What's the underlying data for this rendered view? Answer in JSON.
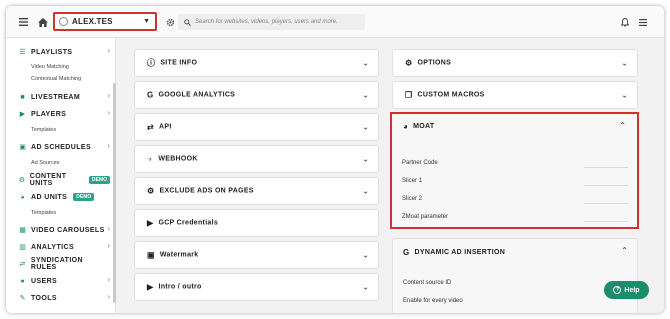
{
  "topbar": {
    "account_name": "ALEX.TES",
    "search_placeholder": "Search for websites, videos, players, users and more."
  },
  "sidebar": {
    "items": [
      {
        "label": "PLAYLISTS",
        "icon": "list-icon"
      },
      {
        "label": "LIVESTREAM",
        "icon": "camera-icon"
      },
      {
        "label": "PLAYERS",
        "icon": "play-circle-icon"
      },
      {
        "label": "AD SCHEDULES",
        "icon": "ad-icon"
      },
      {
        "label": "CONTENT UNITS",
        "icon": "cogs-icon",
        "badge": "DEMO"
      },
      {
        "label": "AD UNITS",
        "icon": "pie-icon",
        "badge": "DEMO"
      },
      {
        "label": "VIDEO CAROUSELS",
        "icon": "carousel-icon"
      },
      {
        "label": "ANALYTICS",
        "icon": "chart-icon"
      },
      {
        "label": "SYNDICATION RULES",
        "icon": "arrows-icon"
      },
      {
        "label": "USERS",
        "icon": "user-icon"
      },
      {
        "label": "TOOLS",
        "icon": "wrench-icon"
      }
    ],
    "subitems": {
      "playlists_1": "Video Matching",
      "playlists_2": "Contextual Matching",
      "players_1": "Templates",
      "ad_schedules_1": "Ad Sources",
      "ad_units_1": "Templates"
    }
  },
  "left_cards": [
    {
      "title": "SITE INFO",
      "icon": "info-icon"
    },
    {
      "title": "GOOGLE ANALYTICS",
      "icon": "google-icon"
    },
    {
      "title": "API",
      "icon": "swap-icon"
    },
    {
      "title": "WEBHOOK",
      "icon": "webhook-icon"
    },
    {
      "title": "EXCLUDE ADS ON PAGES",
      "icon": "cogs-icon"
    },
    {
      "title": "GCP Credentials",
      "icon": "youtube-icon"
    },
    {
      "title": "Watermark",
      "icon": "image-icon"
    },
    {
      "title": "Intro / outro",
      "icon": "play-icon"
    }
  ],
  "right_cards": {
    "options": "OPTIONS",
    "custom_macros": "CUSTOM MACROS",
    "moat": "MOAT",
    "moat_fields": [
      "Partner Code",
      "Slicer 1",
      "Slicer 2",
      "ZMoat parameter"
    ],
    "dynamic_ad": "DYNAMIC AD INSERTION",
    "dynamic_fields": [
      "Content source ID",
      "Enable for every video"
    ]
  },
  "help": {
    "label": "Help"
  },
  "colors": {
    "accent": "#1c8d6b",
    "highlight_border": "#d32f2f"
  }
}
